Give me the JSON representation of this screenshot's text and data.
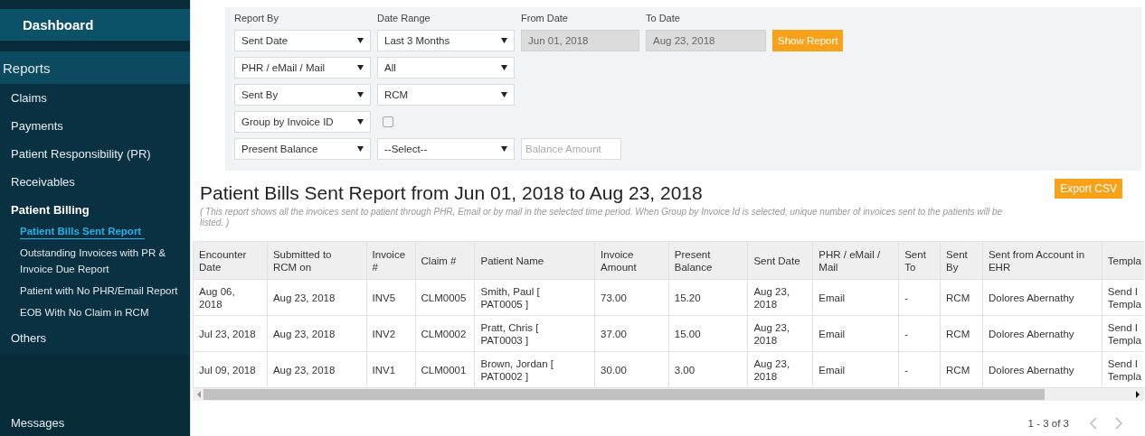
{
  "sidebar": {
    "dashboard": "Dashboard",
    "section": "Reports",
    "items": [
      {
        "label": "Claims",
        "expanded": false
      },
      {
        "label": "Payments",
        "expanded": false
      },
      {
        "label": "Patient Responsibility (PR)",
        "expanded": false
      },
      {
        "label": "Receivables",
        "expanded": false
      },
      {
        "label": "Patient Billing",
        "expanded": true,
        "children": [
          {
            "label": "Patient Bills Sent Report",
            "selected": true
          },
          {
            "label": "Outstanding Invoices with PR & Invoice Due Report",
            "selected": false
          },
          {
            "label": "Patient with No PHR/Email Report",
            "selected": false
          },
          {
            "label": "EOB With No Claim in RCM",
            "selected": false
          }
        ]
      },
      {
        "label": "Others",
        "expanded": false
      }
    ],
    "messages": "Messages"
  },
  "filters": {
    "labels": [
      "Report By",
      "Date Range",
      "From Date",
      "To Date"
    ],
    "rows": [
      [
        {
          "kind": "select",
          "value": "Sent Date"
        },
        {
          "kind": "select",
          "value": "Last 3 Months"
        },
        {
          "kind": "date",
          "value": "Jun 01, 2018",
          "disabled": true
        },
        {
          "kind": "date",
          "value": "Aug 23, 2018",
          "disabled": true
        },
        {
          "kind": "button",
          "label": "Show Report"
        }
      ],
      [
        {
          "kind": "select",
          "value": "PHR / eMail / Mail"
        },
        {
          "kind": "select",
          "value": "All"
        }
      ],
      [
        {
          "kind": "select",
          "value": "Sent By"
        },
        {
          "kind": "select",
          "value": "RCM"
        }
      ],
      [
        {
          "kind": "select",
          "value": "Group by Invoice ID"
        },
        {
          "kind": "checkbox",
          "checked": false
        }
      ],
      [
        {
          "kind": "select",
          "value": "Present Balance"
        },
        {
          "kind": "select",
          "value": "--Select--"
        },
        {
          "kind": "input",
          "placeholder": "Balance Amount"
        }
      ]
    ]
  },
  "report": {
    "title": "Patient Bills Sent Report from Jun 01, 2018 to Aug 23, 2018",
    "export_button": "Export CSV",
    "description": "( This report shows all the invoices sent to patient through PHR, Email or by mail in the selected time period. When Group by Invoice Id is selected, unique number of invoices sent to the patients will be listed. )"
  },
  "table": {
    "columns": [
      "Encounter\nDate",
      "Submitted to\nRCM on",
      "Invoice\n#",
      "Claim #",
      "Patient Name",
      "Invoice\nAmount",
      "Present\nBalance",
      "Sent Date",
      "PHR / eMail /\nMail",
      "Sent\nTo",
      "Sent\nBy",
      "Sent from Account in\nEHR",
      "Templa"
    ],
    "rows": [
      [
        "Aug 06,\n2018",
        "Aug 23, 2018",
        "INV5",
        "CLM0005",
        "Smith, Paul [\nPAT0005 ]",
        "73.00",
        "15.20",
        "Aug 23,\n2018",
        "Email",
        "-",
        "RCM",
        "Dolores Abernathy",
        "Send I\nTempla"
      ],
      [
        "Jul 23, 2018",
        "Aug 23, 2018",
        "INV2",
        "CLM0002",
        "Pratt, Chris [\nPAT0003 ]",
        "37.00",
        "15.00",
        "Aug 23,\n2018",
        "Email",
        "-",
        "RCM",
        "Dolores Abernathy",
        "Send I\nTempla"
      ],
      [
        "Jul 09, 2018",
        "Aug 23, 2018",
        "INV1",
        "CLM0001",
        "Brown, Jordan [\nPAT0002 ]",
        "30.00",
        "3.00",
        "Aug 23,\n2018",
        "Email",
        "-",
        "RCM",
        "Dolores Abernathy",
        "Send I\nTempla"
      ]
    ]
  },
  "pager": {
    "range": "1 - 3 of 3"
  }
}
